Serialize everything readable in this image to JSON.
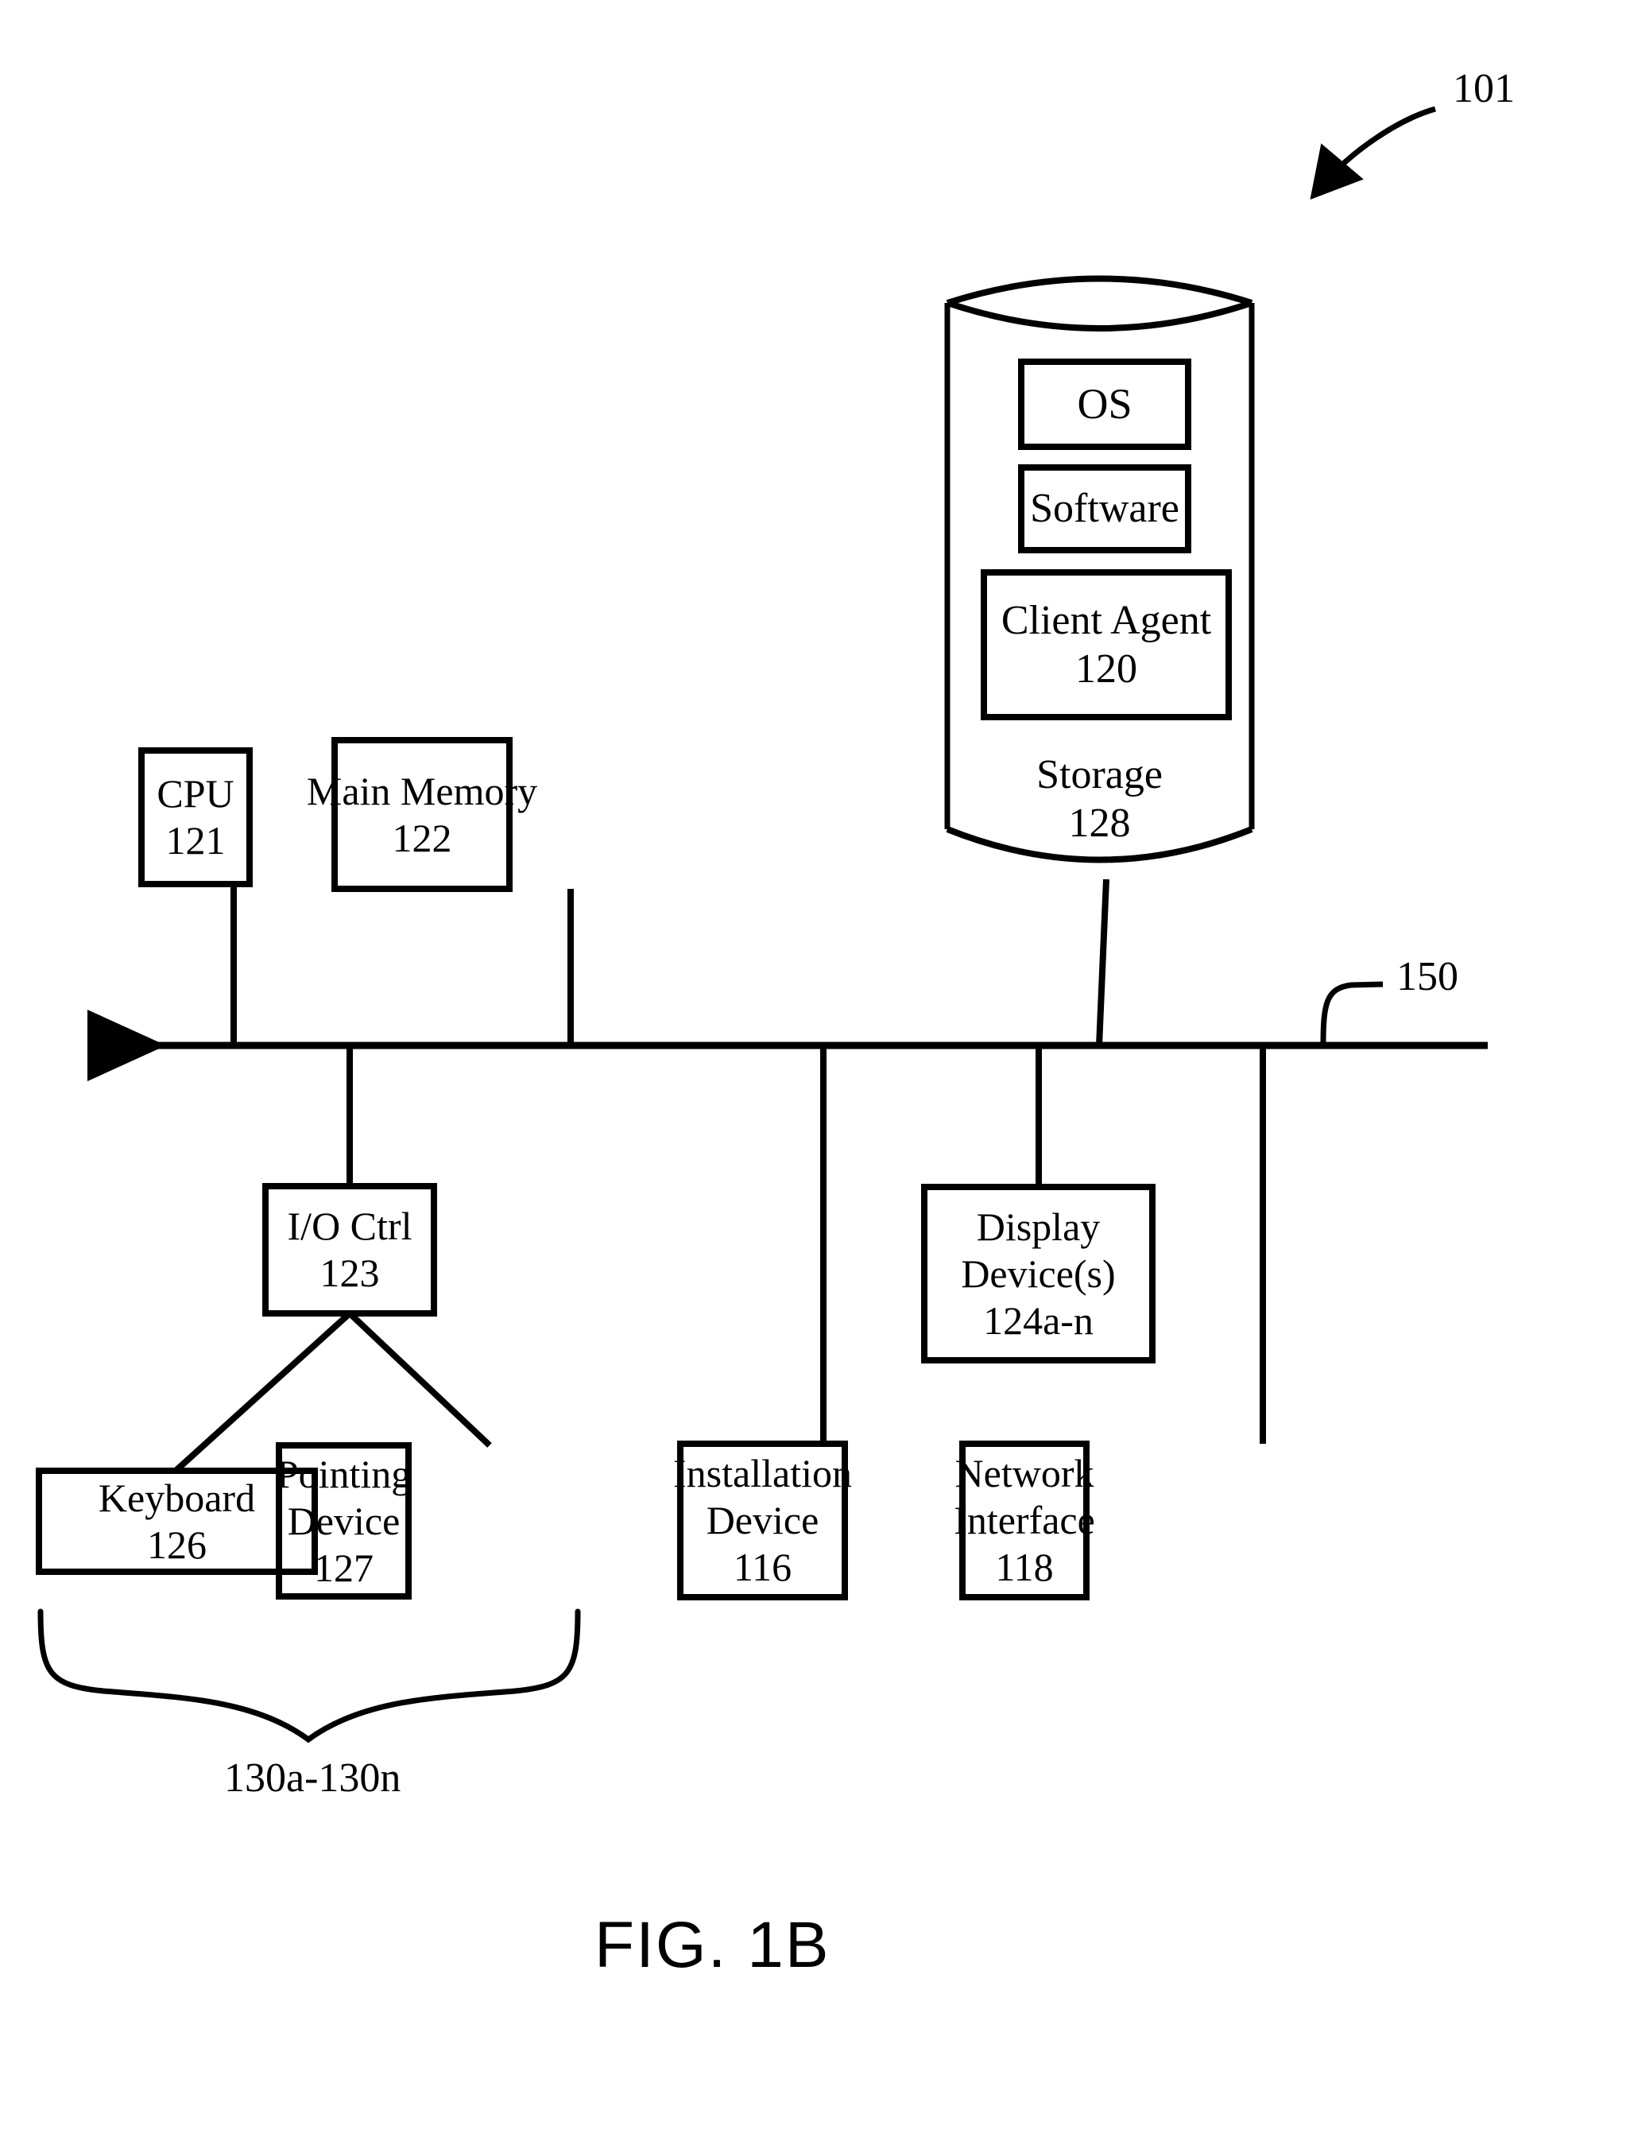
{
  "figure": {
    "caption": "FIG. 1B",
    "callout_101": "101",
    "callout_150": "150",
    "bracket_label": "130a-130n"
  },
  "storage": {
    "title": "Storage",
    "number": "128",
    "items": [
      {
        "label": "OS",
        "number": ""
      },
      {
        "label": "Software",
        "number": ""
      },
      {
        "label": "Client Agent",
        "number": "120"
      }
    ]
  },
  "nodes": [
    {
      "id": "cpu",
      "line1": "CPU",
      "line2": "121",
      "line3": ""
    },
    {
      "id": "main-memory",
      "line1": "Main Memory",
      "line2": "122",
      "line3": ""
    },
    {
      "id": "io-ctrl",
      "line1": "I/O Ctrl",
      "line2": "123",
      "line3": ""
    },
    {
      "id": "display-devices",
      "line1": "Display",
      "line2": "Device(s)",
      "line3": "124a-n"
    },
    {
      "id": "keyboard",
      "line1": "Keyboard",
      "line2": "126",
      "line3": ""
    },
    {
      "id": "pointing-device",
      "line1": "Pointing",
      "line2": "Device",
      "line3": "127"
    },
    {
      "id": "installation-device",
      "line1": "Installation",
      "line2": "Device",
      "line3": "116"
    },
    {
      "id": "network-interface",
      "line1": "Network",
      "line2": "Interface",
      "line3": "118"
    }
  ],
  "colors": {
    "ink": "#000000",
    "paper": "#ffffff"
  }
}
